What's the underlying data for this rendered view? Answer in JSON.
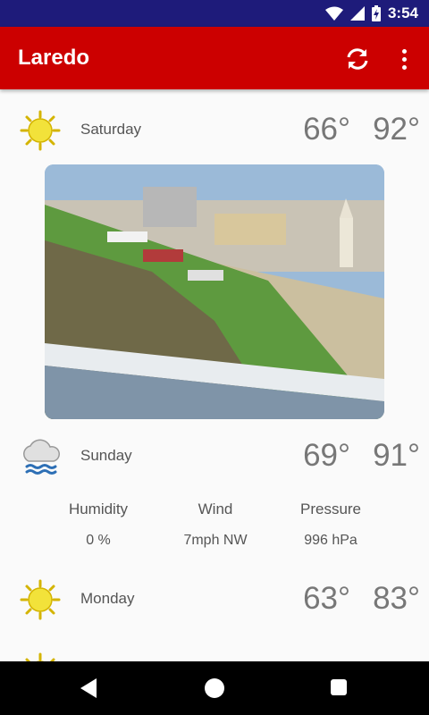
{
  "status_bar": {
    "time": "3:54",
    "icons": [
      "wifi-icon",
      "signal-icon",
      "battery-charging-icon"
    ]
  },
  "app_bar": {
    "title": "Laredo",
    "actions": [
      "refresh-icon",
      "more-vert-icon"
    ]
  },
  "forecast": [
    {
      "day": "Saturday",
      "icon": "sunny-icon",
      "low": "66°",
      "high": "92°"
    },
    {
      "day": "Sunday",
      "icon": "rain-cloud-icon",
      "low": "69°",
      "high": "91°"
    },
    {
      "day": "Monday",
      "icon": "sunny-icon",
      "low": "63°",
      "high": "83°"
    },
    {
      "day": "",
      "icon": "sunny-icon",
      "low": "",
      "high": ""
    }
  ],
  "details": {
    "humidity_label": "Humidity",
    "humidity_value": "0 %",
    "wind_label": "Wind",
    "wind_value": "7mph NW",
    "pressure_label": "Pressure",
    "pressure_value": "996 hPa"
  },
  "colors": {
    "status_bar": "#1e1b7a",
    "app_bar": "#cc0000",
    "sun": "#f2e23a",
    "rain": "#2d6fb5"
  },
  "nav_bar": {
    "buttons": [
      "back-icon",
      "home-icon",
      "recents-icon"
    ]
  }
}
